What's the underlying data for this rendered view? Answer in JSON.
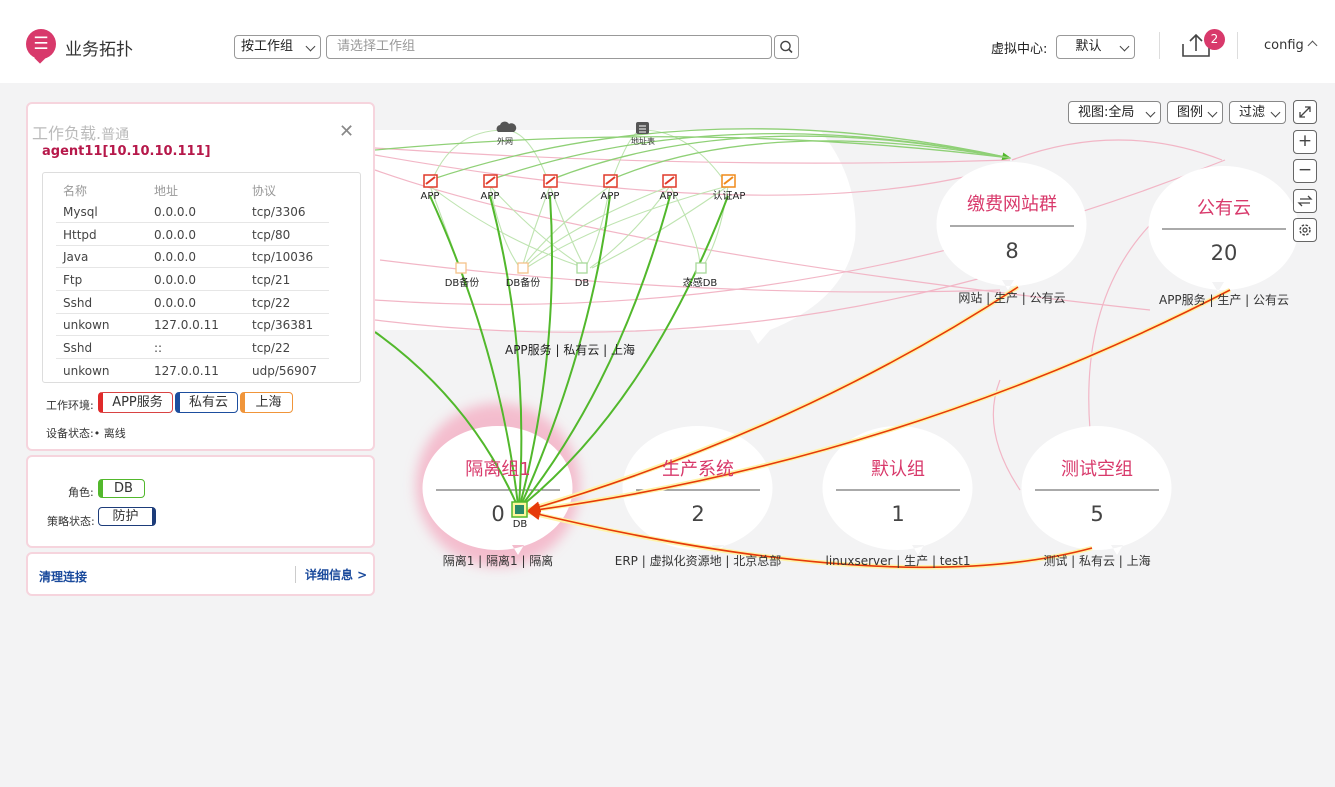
{
  "header": {
    "title": "业务拓扑",
    "group_select": "按工作组",
    "search_placeholder": "请选择工作组",
    "vdc_label": "虚拟中心:",
    "vdc_value": "默认",
    "badge_count": "2",
    "user": "config"
  },
  "toolbar": {
    "view": "视图:全局",
    "legend": "图例",
    "filter": "过滤"
  },
  "workload": {
    "title": "工作负载.",
    "subtitle": "普通",
    "agent": "agent11[10.10.10.111]",
    "columns": [
      "名称",
      "地址",
      "协议"
    ],
    "rows": [
      [
        "Mysql",
        "0.0.0.0",
        "tcp/3306"
      ],
      [
        "Httpd",
        "0.0.0.0",
        "tcp/80"
      ],
      [
        "Java",
        "0.0.0.0",
        "tcp/10036"
      ],
      [
        "Ftp",
        "0.0.0.0",
        "tcp/21"
      ],
      [
        "Sshd",
        "0.0.0.0",
        "tcp/22"
      ],
      [
        "unkown",
        "127.0.0.11",
        "tcp/36381"
      ],
      [
        "Sshd",
        "::",
        "tcp/22"
      ],
      [
        "unkown",
        "127.0.0.11",
        "udp/56907"
      ]
    ],
    "env_label": "工作环境:",
    "env_tags": [
      "APP服务",
      "私有云",
      "上海"
    ],
    "status_label": "设备状态:",
    "status_value": "• 离线",
    "role_label": "角色:",
    "role_value": "DB",
    "policy_label": "策略状态:",
    "policy_value": "防护",
    "clear_link": "清理连接",
    "detail_link": "详细信息 >"
  },
  "topology": {
    "top_icons": [
      {
        "label": "外网",
        "icon": "cloud-icon"
      },
      {
        "label": "地址表",
        "icon": "list-icon"
      }
    ],
    "app_nodes": [
      "APP",
      "APP",
      "APP",
      "APP",
      "APP",
      "认证AP"
    ],
    "db_nodes": [
      "DB备份",
      "DB备份",
      "DB",
      "态感DB"
    ],
    "expanded_group_caption": "APP服务 | 私有云 | 上海",
    "groups": [
      {
        "name": "缴费网站群",
        "count": "8",
        "tags": "网站 | 生产 | 公有云"
      },
      {
        "name": "公有云",
        "count": "20",
        "tags": "APP服务 | 生产 | 公有云"
      },
      {
        "name": "隔离组1",
        "count": "0",
        "tags": "隔离1 | 隔离1 | 隔离",
        "selected_node": "DB"
      },
      {
        "name": "生产系统",
        "count": "2",
        "tags": "ERP | 虚拟化资源地 | 北京总部"
      },
      {
        "name": "默认组",
        "count": "1",
        "tags": "linuxserver | 生产 | test1"
      },
      {
        "name": "测试空组",
        "count": "5",
        "tags": "测试 | 私有云 | 上海"
      }
    ],
    "colors": {
      "brand": "#d8396b",
      "allow_link": "#52b82c",
      "deny_link": "#e63a0a",
      "pink_link": "#f2b6c6"
    }
  }
}
